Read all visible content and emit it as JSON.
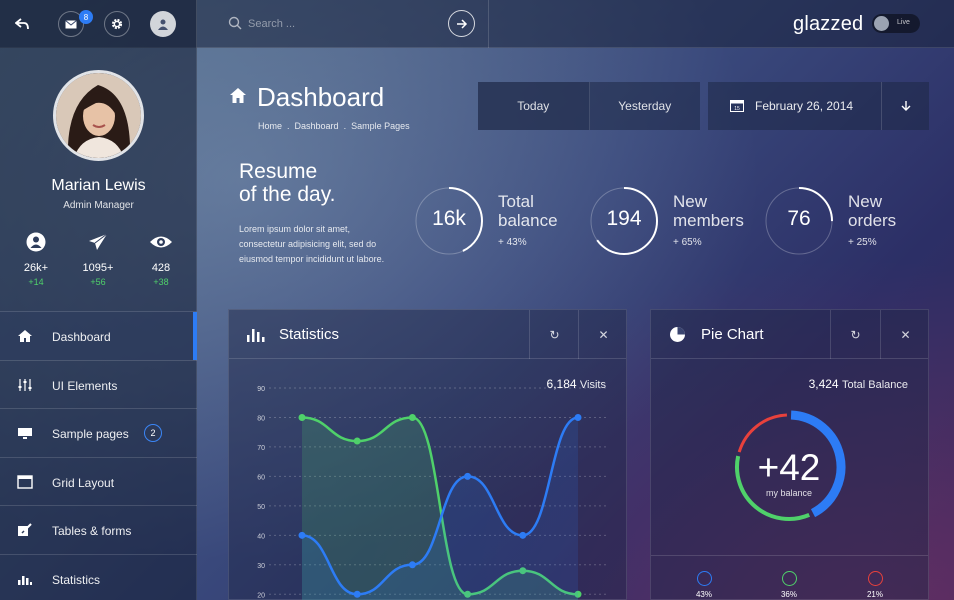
{
  "topbar": {
    "message_count": "8",
    "search_placeholder": "Search ...",
    "brand": "glazzed",
    "live_label": "Live"
  },
  "profile": {
    "name": "Marian Lewis",
    "role": "Admin Manager",
    "stats": [
      {
        "icon": "user-icon",
        "value": "26k+",
        "delta": "+14"
      },
      {
        "icon": "paper-plane-icon",
        "value": "1095+",
        "delta": "+56"
      },
      {
        "icon": "eye-icon",
        "value": "428",
        "delta": "+38"
      }
    ]
  },
  "sidebar": {
    "items": [
      {
        "icon": "home-icon",
        "label": "Dashboard",
        "active": true
      },
      {
        "icon": "sliders-icon",
        "label": "UI Elements"
      },
      {
        "icon": "monitor-icon",
        "label": "Sample pages",
        "badge": "2"
      },
      {
        "icon": "grid-icon",
        "label": "Grid Layout"
      },
      {
        "icon": "edit-icon",
        "label": "Tables & forms"
      },
      {
        "icon": "bar-chart-icon",
        "label": "Statistics"
      }
    ]
  },
  "header": {
    "title": "Dashboard",
    "breadcrumb": [
      "Home",
      "Dashboard",
      "Sample Pages"
    ],
    "filters": [
      "Today",
      "Yesterday"
    ],
    "date": "February 26, 2014",
    "calendar_day": "15"
  },
  "resume": {
    "title_line1": "Resume",
    "title_line2": "of the day.",
    "text": "Lorem ipsum dolor sit amet, consectetur adipisicing elit, sed do eiusmod tempor incididunt ut labore."
  },
  "kpis": [
    {
      "value": "16k",
      "label_line1": "Total",
      "label_line2": "balance",
      "change": "+ 43%",
      "progress": 0.43
    },
    {
      "value": "194",
      "label_line1": "New",
      "label_line2": "members",
      "change": "+ 65%",
      "progress": 0.65
    },
    {
      "value": "76",
      "label_line1": "New",
      "label_line2": "orders",
      "change": "+ 25%",
      "progress": 0.25
    }
  ],
  "statistics": {
    "title": "Statistics",
    "visits_value": "6,184",
    "visits_label": "Visits"
  },
  "pie": {
    "title": "Pie Chart",
    "total_value": "3,424",
    "total_label": "Total Balance",
    "center_value": "+42",
    "center_label": "my balance",
    "legend": [
      {
        "percent": "43%",
        "color": "#2d7cf5"
      },
      {
        "percent": "36%",
        "color": "#4fd16a"
      },
      {
        "percent": "21%",
        "color": "#e8413c"
      }
    ]
  },
  "colors": {
    "accent": "#2d7cf5",
    "green": "#4fd16a",
    "red": "#e8413c"
  },
  "chart_data": [
    {
      "type": "line",
      "x": [
        1,
        2,
        3,
        4,
        5,
        6
      ],
      "ylim": [
        15,
        90
      ],
      "y_ticks": [
        20,
        30,
        40,
        50,
        60,
        70,
        80,
        90
      ],
      "series": [
        {
          "values": [
            80,
            72,
            80,
            20,
            28,
            20
          ],
          "color": "#4fd16a"
        },
        {
          "values": [
            40,
            20,
            30,
            60,
            40,
            80
          ],
          "color": "#2d7cf5"
        }
      ]
    },
    {
      "type": "pie",
      "values": [
        43,
        36,
        21
      ],
      "colors": [
        "#2d7cf5",
        "#4fd16a",
        "#e8413c"
      ]
    }
  ]
}
